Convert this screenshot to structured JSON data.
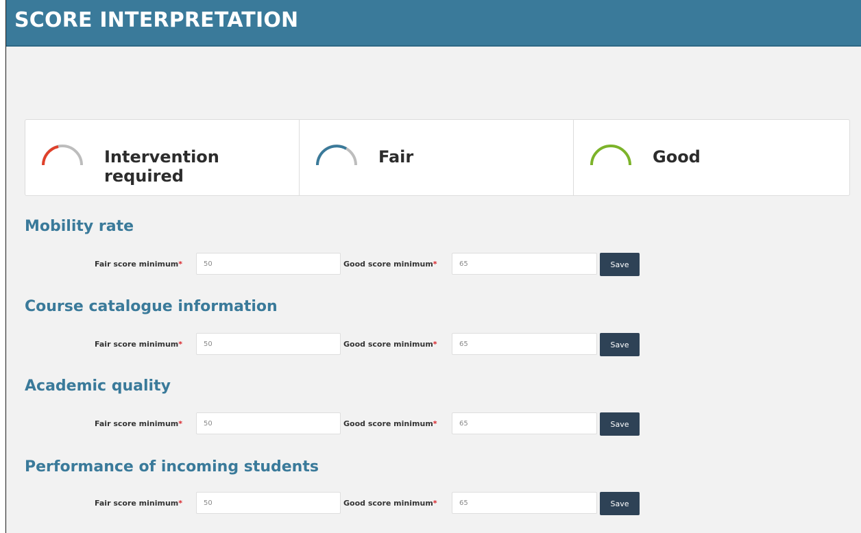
{
  "header": {
    "title": "SCORE INTERPRETATION"
  },
  "legend": [
    {
      "label": "Intervention required",
      "icon": "gauge-low-icon",
      "color": "#e0402a",
      "track": "#bdbdbd"
    },
    {
      "label": "Fair",
      "icon": "gauge-fair-icon",
      "color": "#3a7a9a",
      "track": "#bdbdbd"
    },
    {
      "label": "Good",
      "icon": "gauge-good-icon",
      "color": "#7cb32a",
      "track": "#bdbdbd"
    }
  ],
  "sections": [
    {
      "title": "Mobility rate",
      "fair_label": "Fair score minimum",
      "fair_value": "50",
      "good_label": "Good score minimum",
      "good_value": "65",
      "save_label": "Save"
    },
    {
      "title": "Course catalogue information",
      "fair_label": "Fair score minimum",
      "fair_value": "50",
      "good_label": "Good score minimum",
      "good_value": "65",
      "save_label": "Save"
    },
    {
      "title": "Academic quality",
      "fair_label": "Fair score minimum",
      "fair_value": "50",
      "good_label": "Good score minimum",
      "good_value": "65",
      "save_label": "Save"
    },
    {
      "title": "Performance of incoming students",
      "fair_label": "Fair score minimum",
      "fair_value": "50",
      "good_label": "Good score minimum",
      "good_value": "65",
      "save_label": "Save"
    }
  ],
  "required_marker": "*",
  "colors": {
    "header": "#3a7a9a",
    "section_title": "#3a7a9a",
    "button": "#2e4256",
    "required": "#d9262c"
  }
}
